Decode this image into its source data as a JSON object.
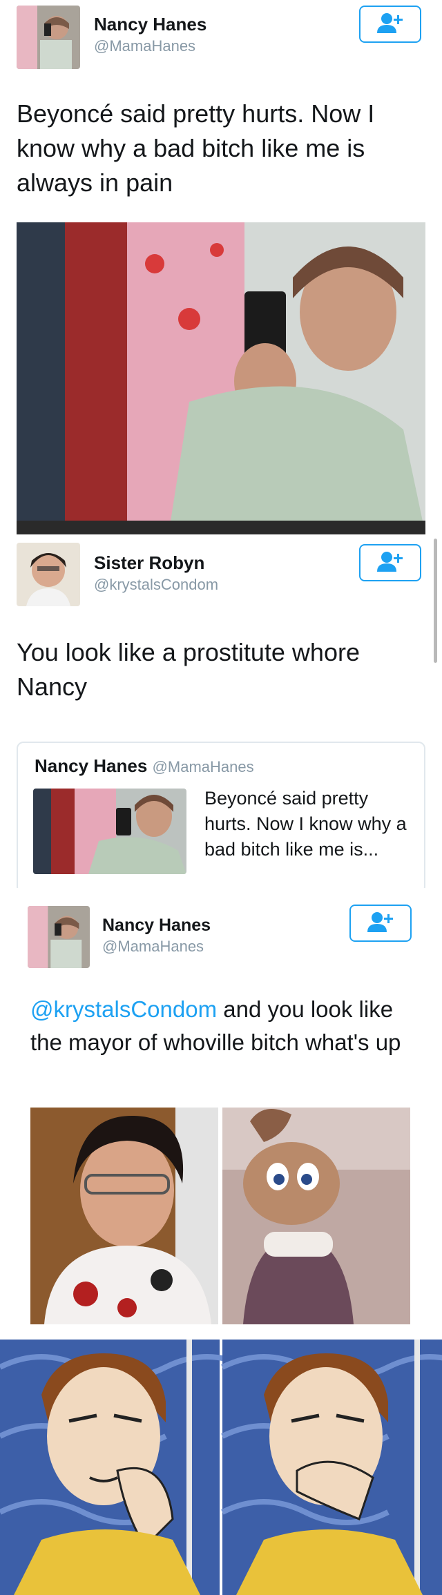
{
  "tweet1": {
    "name": "Nancy Hanes",
    "handle": "@MamaHanes",
    "text": "Beyoncé said pretty hurts. Now I know why a bad bitch like me is always in pain"
  },
  "tweet2": {
    "name": "Sister Robyn",
    "handle": "@krystalsCondom",
    "text": "You look like a prostitute whore Nancy",
    "quote": {
      "name": "Nancy Hanes",
      "handle": "@MamaHanes",
      "text": "Beyoncé said pretty hurts. Now I know why a bad bitch like me is..."
    }
  },
  "tweet3": {
    "name": "Nancy Hanes",
    "handle": "@MamaHanes",
    "mention": "@krystalsCondom",
    "text": " and you look like the mayor of whoville bitch what's up"
  },
  "icons": {
    "follow": "add-user-icon",
    "accent": "#1da1f2"
  }
}
